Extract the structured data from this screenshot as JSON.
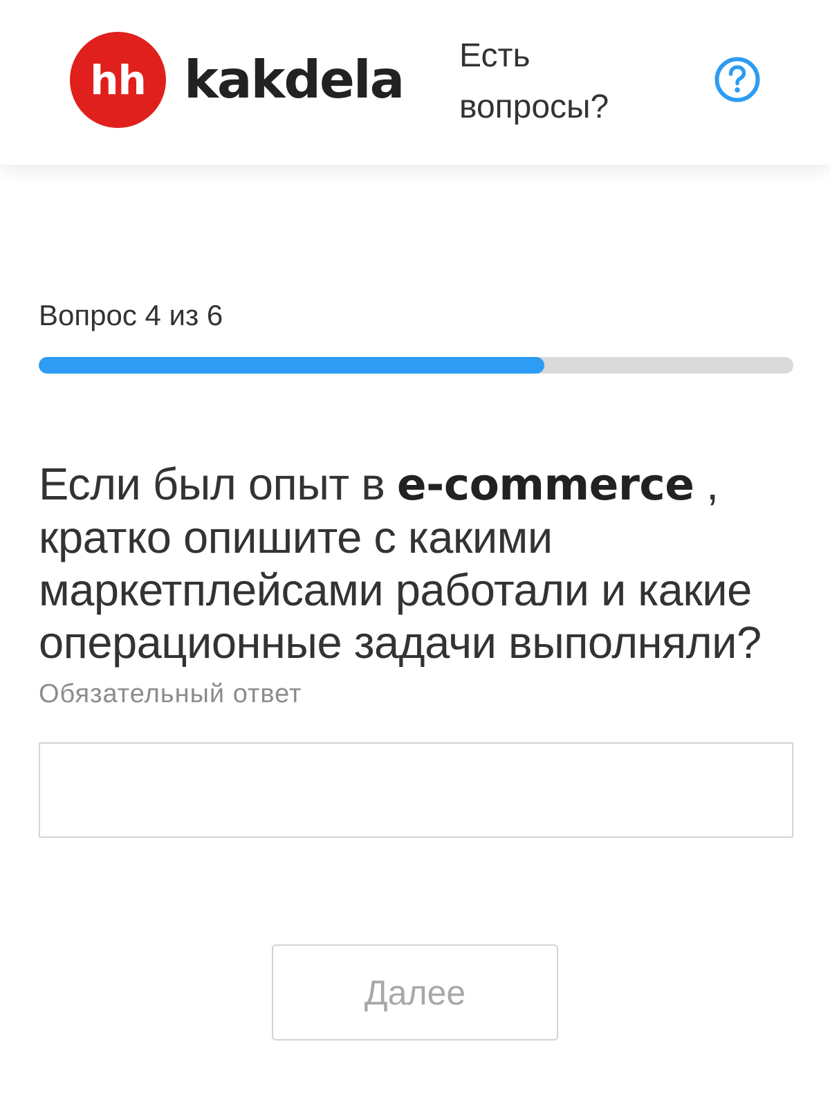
{
  "header": {
    "logo_text": "hh",
    "brand_name": "kakdela",
    "help_line1": "Есть",
    "help_line2": "вопросы?",
    "help_icon": "question-circle-icon",
    "logo_color": "#e0201c",
    "help_icon_color": "#2d9cf2"
  },
  "progress": {
    "label": "Вопрос 4 из 6",
    "fraction": 0.67,
    "fill_color": "#2d9cf2",
    "track_color": "#dadada"
  },
  "question": {
    "text_before": "Если был опыт в ",
    "text_bold": "e-commerce",
    "text_after": " , кратко опишите с какими маркетплейсами работали и какие операционные задачи  выполняли?",
    "required_note": "Обязательный ответ"
  },
  "answer": {
    "value": "",
    "placeholder": ""
  },
  "footer": {
    "next_label": "Далее"
  }
}
